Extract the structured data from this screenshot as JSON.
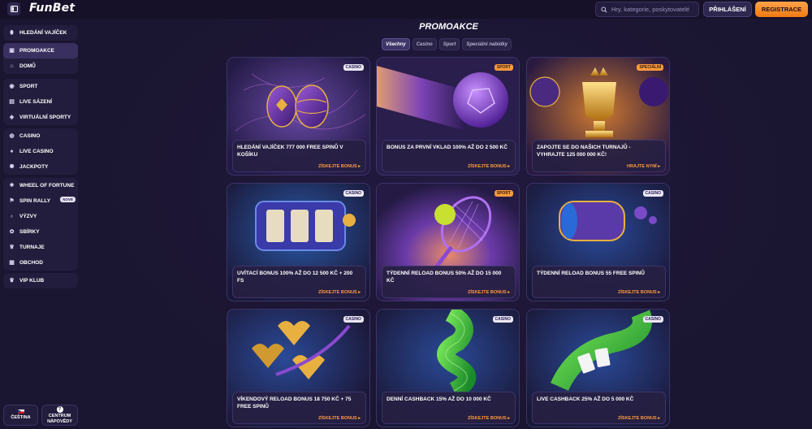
{
  "brand": "FunBet",
  "header": {
    "search_placeholder": "Hry, kategorie, poskytovatelé",
    "login_label": "PŘIHLÁŠENÍ",
    "register_label": "REGISTRACE"
  },
  "sidebar": {
    "items": [
      {
        "label": "HLEDÁNÍ VAJÍČEK",
        "icon": "egg-icon"
      },
      {
        "label": "PROMOAKCE",
        "icon": "gift-icon"
      },
      {
        "label": "DOMŮ",
        "icon": "home-icon"
      },
      {
        "label": "SPORT",
        "icon": "ball-icon"
      },
      {
        "label": "LIVE SÁZENÍ",
        "icon": "live-icon"
      },
      {
        "label": "VIRTUÁLNÍ SPORTY",
        "icon": "virtual-icon"
      },
      {
        "label": "CASINO",
        "icon": "chip-icon"
      },
      {
        "label": "LIVE CASINO",
        "icon": "dealer-icon"
      },
      {
        "label": "JACKPOTY",
        "icon": "jackpot-icon"
      },
      {
        "label": "WHEEL OF FORTUNE",
        "icon": "wheel-icon"
      },
      {
        "label": "SPIN RALLY",
        "icon": "rally-icon",
        "badge": "NOVÉ"
      },
      {
        "label": "VÝZVY",
        "icon": "challenge-icon"
      },
      {
        "label": "SBÍRKY",
        "icon": "collection-icon"
      },
      {
        "label": "TURNAJE",
        "icon": "trophy-icon"
      },
      {
        "label": "OBCHOD",
        "icon": "shop-icon"
      },
      {
        "label": "VIP KLUB",
        "icon": "vip-icon"
      }
    ],
    "language_label": "ČEŠTINA",
    "help_label_1": "CENTRUM",
    "help_label_2": "NÁPOVĚDY"
  },
  "main": {
    "title": "PROMOAKCE",
    "tabs": [
      "Všechny",
      "Casino",
      "Sport",
      "Speciální nabídky"
    ],
    "cards": [
      {
        "tag": "CASINO",
        "title": "HLEDÁNÍ VAJÍČEK 777 000 FREE SPINŮ V KOŠÍKU",
        "cta": "ZÍSKEJTE BONUS ▸"
      },
      {
        "tag": "SPORT",
        "title": "BONUS ZA PRVNÍ VKLAD 100% AŽ DO 2 500 KČ",
        "cta": "ZÍSKEJTE BONUS ▸"
      },
      {
        "tag": "SPECIÁLNÍ",
        "title": "ZAPOJTE SE DO NAŠICH TURNAJŮ - VYHRAJTE 125 000 000 KČ!",
        "cta": "HRAJTE NYNÍ ▸"
      },
      {
        "tag": "CASINO",
        "title": "UVÍTACÍ BONUS 100% AŽ DO 12 500 KČ + 200 FS",
        "cta": "ZÍSKEJTE BONUS ▸"
      },
      {
        "tag": "SPORT",
        "title": "TÝDENNÍ RELOAD BONUS 50% AŽ DO 15 000 KČ",
        "cta": "ZÍSKEJTE BONUS ▸"
      },
      {
        "tag": "CASINO",
        "title": "TÝDENNÍ RELOAD BONUS 55 FREE SPINŮ",
        "cta": "ZÍSKEJTE BONUS ▸"
      },
      {
        "tag": "CASINO",
        "title": "VÍKENDOVÝ RELOAD BONUS 18 750 KČ + 75 FREE SPINŮ",
        "cta": "ZÍSKEJTE BONUS ▸"
      },
      {
        "tag": "CASINO",
        "title": "DENNÍ CASHBACK 15% AŽ DO 10 000 KČ",
        "cta": "ZÍSKEJTE BONUS ▸"
      },
      {
        "tag": "CASINO",
        "title": "LIVE CASHBACK 25% AŽ DO 5 000 KČ",
        "cta": "ZÍSKEJTE BONUS ▸"
      }
    ]
  },
  "colors": {
    "background": "#1a1530",
    "panel": "#231d3d",
    "accent_orange": "#ff9a3d"
  }
}
